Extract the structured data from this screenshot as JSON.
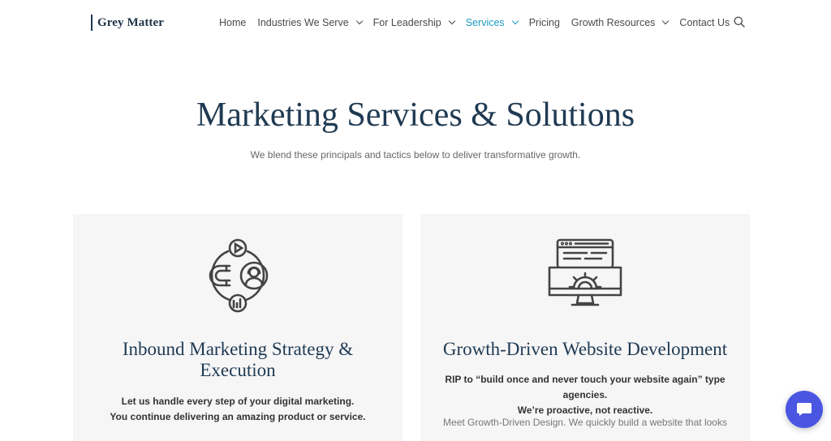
{
  "header": {
    "logo_text": "Grey Matter",
    "nav": [
      {
        "label": "Home",
        "dropdown": false,
        "active": false
      },
      {
        "label": "Industries We Serve",
        "dropdown": true,
        "active": false
      },
      {
        "label": "For Leadership",
        "dropdown": true,
        "active": false
      },
      {
        "label": "Services",
        "dropdown": true,
        "active": true
      },
      {
        "label": "Pricing",
        "dropdown": false,
        "active": false
      },
      {
        "label": "Growth Resources",
        "dropdown": true,
        "active": false
      },
      {
        "label": "Contact Us",
        "dropdown": false,
        "active": false
      }
    ],
    "search_icon": "search-icon"
  },
  "hero": {
    "title": "Marketing Services & Solutions",
    "subtitle": "We blend these principals and tactics below to deliver transformative growth."
  },
  "cards": [
    {
      "icon": "inbound-marketing-icon",
      "title": "Inbound Marketing Strategy & Execution",
      "bold_lines": [
        "Let us handle every step of your digital marketing.",
        "You continue delivering an amazing product or service."
      ],
      "body": ""
    },
    {
      "icon": "website-development-icon",
      "title": "Growth-Driven Website Development",
      "bold_lines": [
        "RIP to “build once and never touch your website again” type agencies.",
        "We’re proactive, not reactive."
      ],
      "body": "Meet Growth-Driven Design. We quickly build a website that looks"
    }
  ],
  "chat": {
    "icon": "chat-icon"
  },
  "colors": {
    "accent": "#1a9bc2",
    "heading": "#1f3a52",
    "chat": "#4a56e2",
    "card_bg": "#f6f6f7"
  }
}
